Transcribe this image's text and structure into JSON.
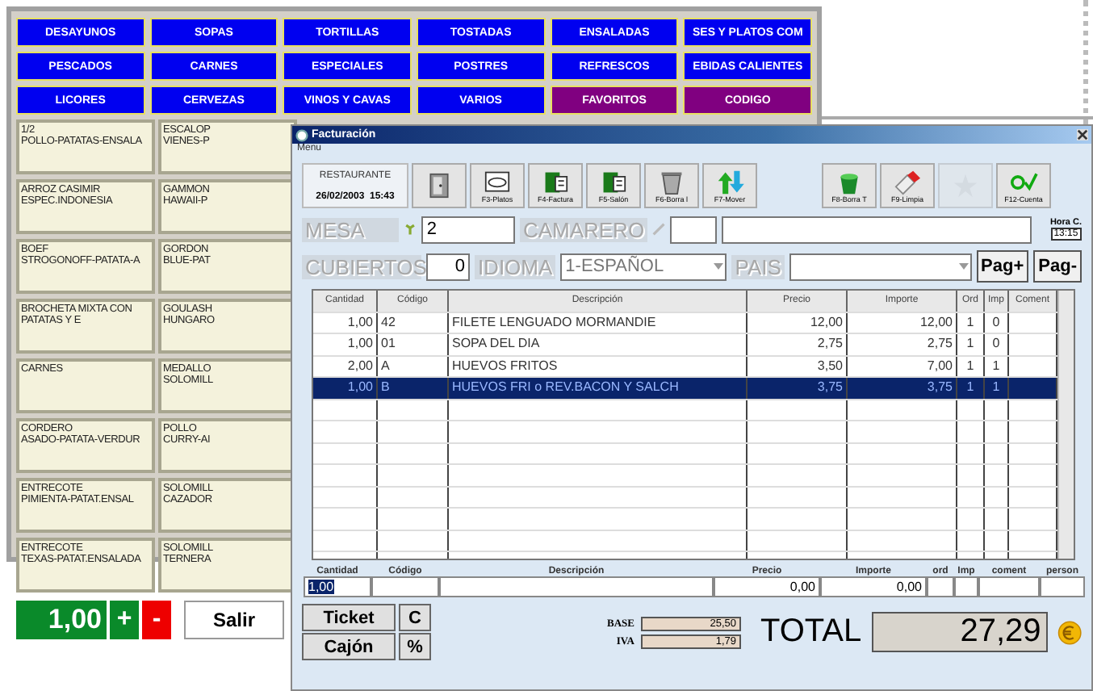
{
  "back_window": {
    "categories": [
      {
        "label": "DESAYUNOS",
        "kind": "category"
      },
      {
        "label": "SOPAS",
        "kind": "category"
      },
      {
        "label": "TORTILLAS",
        "kind": "category"
      },
      {
        "label": "TOSTADAS",
        "kind": "category"
      },
      {
        "label": "ENSALADAS",
        "kind": "category"
      },
      {
        "label": "SES Y PLATOS COM",
        "kind": "category"
      },
      {
        "label": "PESCADOS",
        "kind": "category"
      },
      {
        "label": "CARNES",
        "kind": "category"
      },
      {
        "label": "ESPECIALES",
        "kind": "category"
      },
      {
        "label": "POSTRES",
        "kind": "category"
      },
      {
        "label": "REFRESCOS",
        "kind": "category"
      },
      {
        "label": "EBIDAS CALIENTES",
        "kind": "category"
      },
      {
        "label": "LICORES",
        "kind": "category"
      },
      {
        "label": "CERVEZAS",
        "kind": "category"
      },
      {
        "label": "VINOS Y CAVAS",
        "kind": "category"
      },
      {
        "label": "VARIOS",
        "kind": "category"
      },
      {
        "label": "FAVORITOS",
        "kind": "special"
      },
      {
        "label": "CODIGO",
        "kind": "special"
      }
    ],
    "item_rows": [
      [
        {
          "lines": [
            "1/2",
            "POLLO-PATATAS-ENSALA"
          ]
        },
        {
          "lines": [
            "ESCALOP",
            "VIENES-P"
          ]
        }
      ],
      [
        {
          "lines": [
            "ARROZ CASIMIR",
            "ESPEC.INDONESIA"
          ]
        },
        {
          "lines": [
            "GAMMON",
            "HAWAII-P"
          ]
        }
      ],
      [
        {
          "lines": [
            "BOEF",
            "STROGONOFF-PATATA-A"
          ]
        },
        {
          "lines": [
            "GORDON",
            "BLUE-PAT"
          ]
        }
      ],
      [
        {
          "lines": [
            "BROCHETA MIXTA CON",
            "PATATAS Y E"
          ]
        },
        {
          "lines": [
            "GOULASH",
            "HUNGARO"
          ]
        }
      ],
      [
        {
          "lines": [
            "CARNES"
          ]
        },
        {
          "lines": [
            "MEDALLO",
            "SOLOMILL"
          ]
        }
      ],
      [
        {
          "lines": [
            "CORDERO",
            "ASADO-PATATA-VERDUR"
          ]
        },
        {
          "lines": [
            "POLLO",
            "CURRY-AI"
          ]
        }
      ],
      [
        {
          "lines": [
            "ENTRECOTE",
            "PIMIENTA-PATAT.ENSAL"
          ]
        },
        {
          "lines": [
            "SOLOMILL",
            "CAZADOR"
          ]
        }
      ],
      [
        {
          "lines": [
            "ENTRECOTE",
            "TEXAS-PATAT.ENSALADA"
          ]
        },
        {
          "lines": [
            "SOLOMILL",
            "TERNERA"
          ]
        }
      ]
    ],
    "quantity": "1,00",
    "plus": "+",
    "minus": "-",
    "exit": "Salir"
  },
  "dialog": {
    "title": "Facturación",
    "menu": [
      "Menu"
    ],
    "venue": "RESTAURANTE",
    "datetime": "26/02/2003  15:43",
    "toolbar": [
      {
        "kind": "door",
        "disabled": false
      },
      {
        "kind": "plate",
        "label": "F3-Platos",
        "disabled": false
      },
      {
        "kind": "book",
        "label": "F4-Factura",
        "disabled": false
      },
      {
        "kind": "book",
        "label": "F5-Salón",
        "disabled": false
      },
      {
        "kind": "trash",
        "label": "F6-Borra l",
        "disabled": false
      },
      {
        "kind": "arrows",
        "label": "F7-Mover",
        "disabled": false
      },
      {
        "kind": "bucket",
        "label": "F8-Borra T",
        "disabled": false
      },
      {
        "kind": "eraser",
        "label": "F9-Limpia",
        "disabled": false
      },
      {
        "kind": "star",
        "disabled": true
      },
      {
        "kind": "ok",
        "label": "F12-Cuenta",
        "disabled": false
      }
    ],
    "mesa_label": "MESA",
    "mesa": "2",
    "waiter_label": "CAMARERO",
    "time_label": "Hora C.",
    "time": "13:15",
    "covers_label": "CUBIERTOS",
    "covers": "0",
    "language_label": "IDIOMA",
    "language": "1-ESPAÑOL",
    "country_label": "PAIS",
    "page_up": "Pag+",
    "page_down": "Pag-",
    "columns": [
      "Cantidad",
      "Código",
      "Descripción",
      "Precio",
      "Importe",
      "Ord",
      "Imp",
      "Coment"
    ],
    "rows": [
      {
        "cells": [
          "1,00",
          "42",
          "FILETE LENGUADO MORMANDIE",
          "12,00",
          "12,00",
          "1",
          "0"
        ],
        "selected": false
      },
      {
        "cells": [
          "1,00",
          "01",
          "SOPA DEL DIA",
          "2,75",
          "2,75",
          "1",
          "0"
        ],
        "selected": false
      },
      {
        "cells": [
          "2,00",
          "A",
          "HUEVOS FRITOS",
          "3,50",
          "7,00",
          "1",
          "1"
        ],
        "selected": false
      },
      {
        "cells": [
          "1,00",
          "B",
          "HUEVOS FRI o REV.BACON Y SALCH",
          "3,75",
          "3,75",
          "1",
          "1"
        ],
        "selected": true
      }
    ],
    "entry_columns": [
      "Cantidad",
      "Código",
      "Descripción",
      "Precio",
      "Importe",
      "ord",
      "Imp",
      "coment",
      "person"
    ],
    "entry": {
      "quantity": "1,00",
      "price": "0,00",
      "amount": "0,00"
    },
    "ticket": "Ticket",
    "clear": "C",
    "drawer": "Cajón",
    "percent": "%",
    "base_label": "BASE",
    "base": "25,50",
    "tax_label": "IVA",
    "tax": "1,79",
    "total_label": "TOTAL",
    "total": "27,29"
  }
}
